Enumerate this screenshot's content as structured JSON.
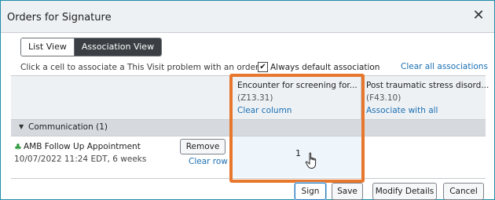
{
  "window": {
    "title": "Orders for Signature",
    "close_glyph": "✕"
  },
  "view_toggle": {
    "list_label": "List View",
    "association_label": "Association View",
    "active": "Association View"
  },
  "hint_text": "Click a cell to associate a This Visit problem with an order.",
  "always_default": {
    "label": "Always default association",
    "checked": true,
    "check_glyph": "✔"
  },
  "clear_all_label": "Clear all associations",
  "columns": [
    {
      "name": "Encounter for screening for...",
      "code": "(Z13.31)",
      "link": "Clear column"
    },
    {
      "name": "Post traumatic stress disord...",
      "code": "(F43.10)",
      "link": "Associate with all"
    }
  ],
  "section": {
    "label": "Communication (1)",
    "caret_glyph": "▼"
  },
  "order": {
    "icon": "order-status-icon",
    "icon_glyph": "♣",
    "name": "AMB Follow Up Appointment",
    "detail": "10/07/2022 11:24 EDT, 6 weeks",
    "remove_label": "Remove",
    "clear_row_label": "Clear row",
    "association_value": "1"
  },
  "footer": {
    "sign": "Sign",
    "save": "Save",
    "modify": "Modify Details",
    "cancel": "Cancel"
  },
  "colors": {
    "highlight": "#e8772e",
    "link": "#1a6fb3",
    "active_toggle": "#3b3f44"
  }
}
